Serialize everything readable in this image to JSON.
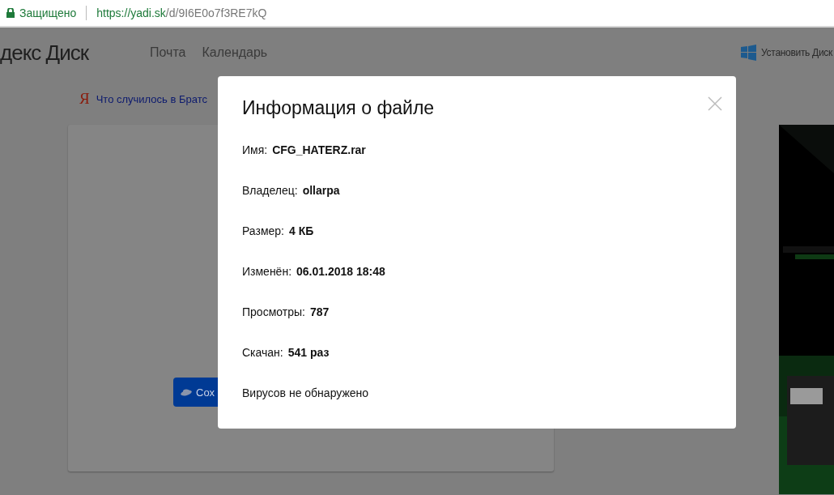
{
  "address_bar": {
    "secure_label": "Защищено",
    "url_host": "https://yadi.sk",
    "url_path": "/d/9I6E0o7f3RE7kQ"
  },
  "header": {
    "logo": "декс Диск",
    "nav": [
      "Почта",
      "Календарь"
    ],
    "install": "Установить Диск"
  },
  "promo": {
    "mark": "Я",
    "text": "Что случилось в Братс"
  },
  "save_button": {
    "label": "Сох"
  },
  "dialog": {
    "title": "Информация о файле",
    "fields": [
      {
        "label": "Имя:",
        "value": "CFG_HATERZ.rar"
      },
      {
        "label": "Владелец:",
        "value": "ollarpa"
      },
      {
        "label": "Размер:",
        "value": "4 КБ"
      },
      {
        "label": "Изменён:",
        "value": "06.01.2018 18:48"
      },
      {
        "label": "Просмотры:",
        "value": "787"
      },
      {
        "label": "Скачан:",
        "value": "541 раз"
      }
    ],
    "note": "Вирусов не обнаружено"
  }
}
